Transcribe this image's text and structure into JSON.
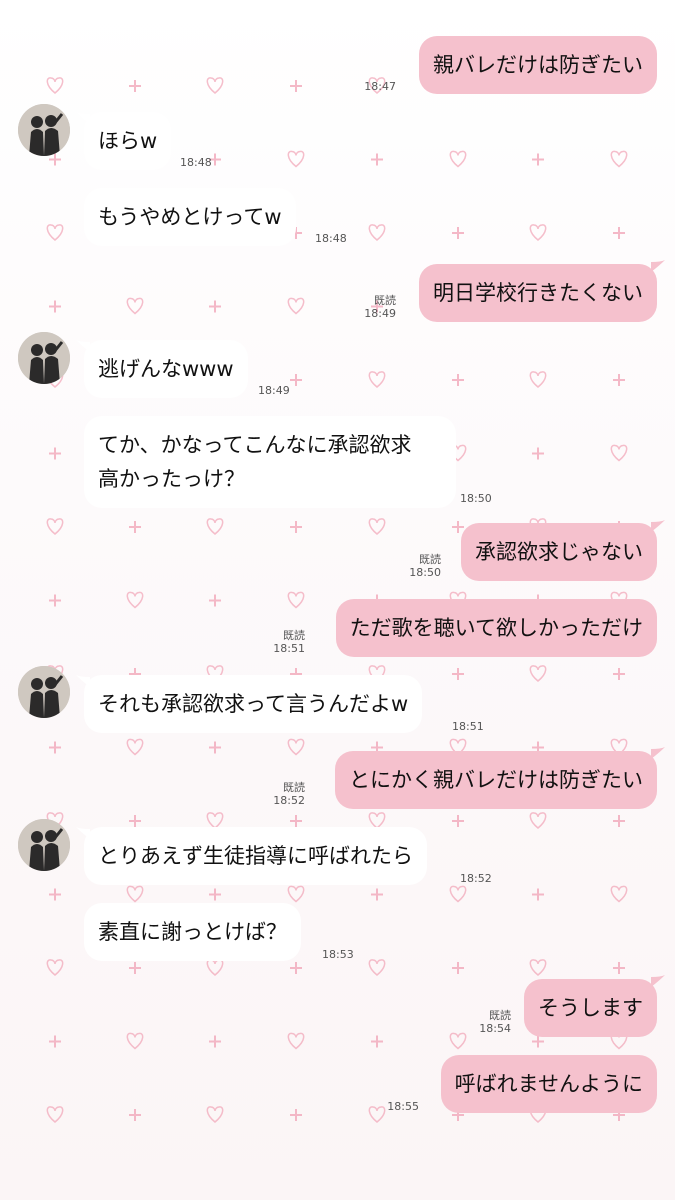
{
  "theme": {
    "accent": "#f5c1cd",
    "pattern_color": "#f2a8ba",
    "incoming_bubble": "#ffffff"
  },
  "pattern": {
    "icons": [
      "heart-icon",
      "plus-icon"
    ]
  },
  "messages": [
    {
      "side": "out",
      "text": "親バレだけは防ぎたい",
      "time": "18:47",
      "read": ""
    },
    {
      "side": "in",
      "avatar": true,
      "text": "ほらw",
      "time": "18:48"
    },
    {
      "side": "in",
      "text": "もうやめとけってw",
      "time": "18:48"
    },
    {
      "side": "out",
      "text": "明日学校行きたくない",
      "time": "18:49",
      "read": "既読"
    },
    {
      "side": "in",
      "avatar": true,
      "text": "逃げんなwww",
      "time": "18:49"
    },
    {
      "side": "in",
      "lines": [
        "てか、かなってこんなに承認欲求",
        "高かったっけ？"
      ],
      "time": "18:50"
    },
    {
      "side": "out",
      "text": "承認欲求じゃない",
      "time": "18:50",
      "read": "既読"
    },
    {
      "side": "out",
      "text": "ただ歌を聴いて欲しかっただけ",
      "time": "18:51",
      "read": "既読"
    },
    {
      "side": "in",
      "avatar": true,
      "text": "それも承認欲求って言うんだよw",
      "time": "18:51"
    },
    {
      "side": "out",
      "text": "とにかく親バレだけは防ぎたい",
      "time": "18:52",
      "read": "既読"
    },
    {
      "side": "in",
      "avatar": true,
      "text": "とりあえず生徒指導に呼ばれたら",
      "time": "18:52"
    },
    {
      "side": "in",
      "text": "素直に謝っとけば？",
      "time": "18:53"
    },
    {
      "side": "out",
      "text": "そうします",
      "time": "18:54",
      "read": "既読"
    },
    {
      "side": "out",
      "text": "呼ばれませんように",
      "time": "18:55",
      "read": ""
    }
  ]
}
